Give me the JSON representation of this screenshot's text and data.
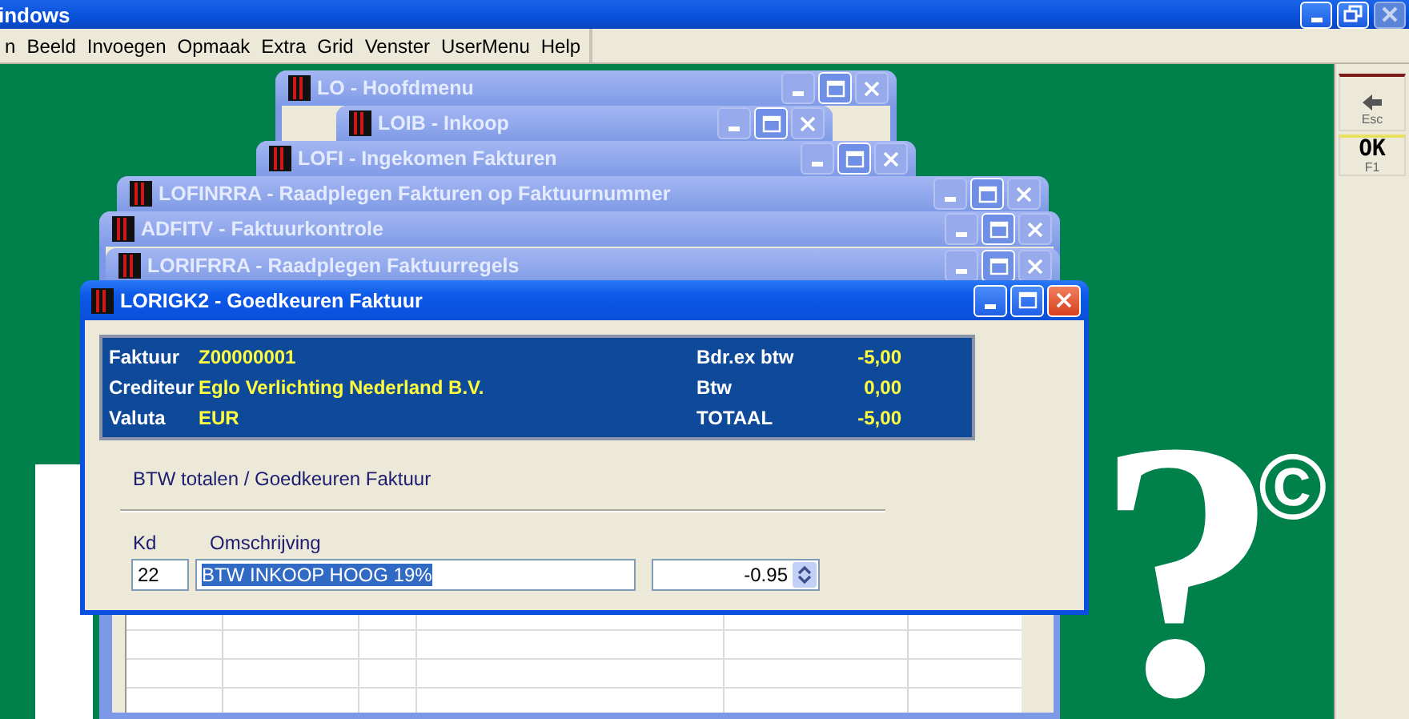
{
  "app_title": "indows",
  "menu": [
    "n",
    "Beeld",
    "Invoegen",
    "Opmaak",
    "Extra",
    "Grid",
    "Venster",
    "UserMenu",
    "Help"
  ],
  "toolbar": [
    {
      "kind": "icon",
      "key": "Esc"
    },
    {
      "kind": "text",
      "label": "OK",
      "key": "F1"
    }
  ],
  "logo": {
    "mark": "?",
    "symbol": "©"
  },
  "windows": [
    {
      "title": "LO - Hoofdmenu",
      "active": false,
      "kind": "plain"
    },
    {
      "title": "LOIB - Inkoop",
      "active": false,
      "kind": "plain"
    },
    {
      "title": "LOFI - Ingekomen Fakturen",
      "active": false,
      "kind": "plain"
    },
    {
      "title": "LOFINRRA - Raadplegen Fakturen op Faktuurnummer",
      "active": false,
      "kind": "plain"
    },
    {
      "title": "ADFITV - Faktuurkontrole",
      "active": false,
      "kind": "plain"
    },
    {
      "title": "LORIFRRA - Raadplegen Faktuurregels",
      "active": false,
      "kind": "grid"
    },
    {
      "title": "LORIGK2 - Goedkeuren Faktuur",
      "active": true,
      "kind": "form"
    }
  ],
  "invoice": [
    {
      "label": "Faktuur",
      "value": "Z00000001",
      "label2": "Bdr.ex btw",
      "value2": "-5,00"
    },
    {
      "label": "Crediteur",
      "value": "Eglo Verlichting Nederland B.V.",
      "label2": "Btw",
      "value2": "0,00"
    },
    {
      "label": "Valuta",
      "value": "EUR",
      "label2": "TOTAAL",
      "value2": "-5,00"
    }
  ],
  "section_title": "BTW totalen / Goedkeuren Faktuur",
  "form": {
    "kd_label": "Kd",
    "desc_label": "Omschrijving",
    "kd": "22",
    "description": "BTW INKOOP HOOG 19%",
    "description_selected": true,
    "amount": "-0.95"
  }
}
